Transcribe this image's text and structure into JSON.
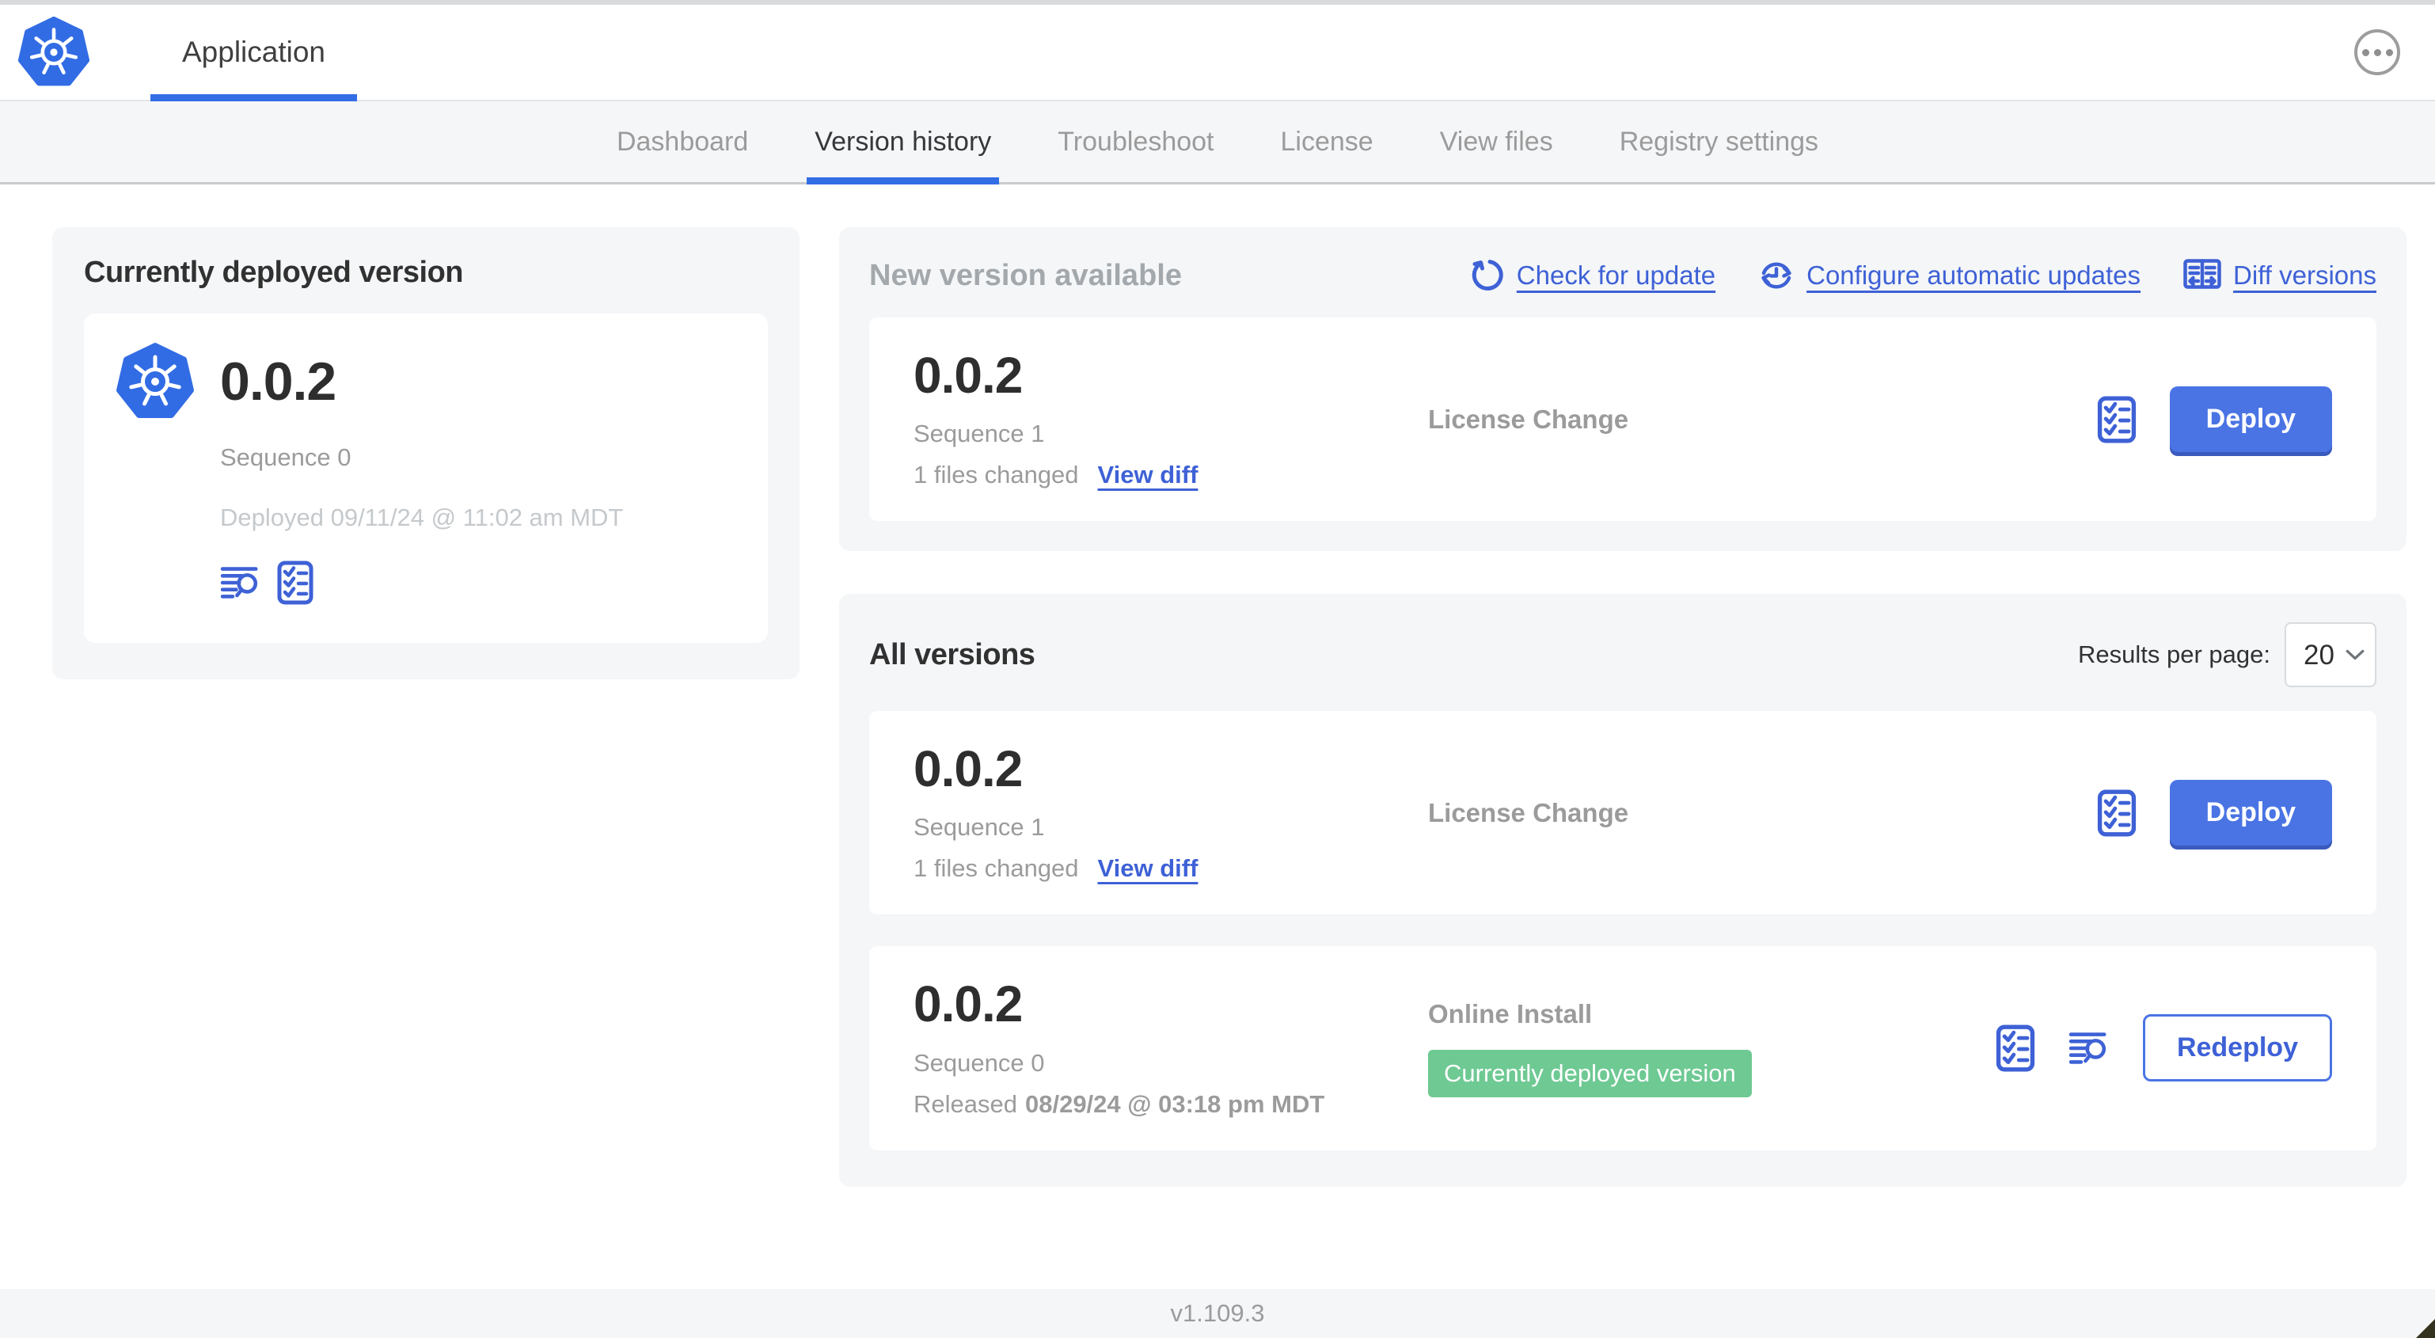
{
  "colors": {
    "accent_blue": "#326de6",
    "link_blue": "#3e61d6",
    "button_blue": "#4a74e4",
    "badge_green": "#6ec993",
    "panel_gray": "#f4f6f8"
  },
  "header": {
    "app_tab_label": "Application",
    "logo_icon": "kubernetes-wheel",
    "menu_icon": "ellipsis-circle"
  },
  "nav": {
    "active_tab": "Version history",
    "tabs": [
      {
        "label": "Dashboard"
      },
      {
        "label": "Version history"
      },
      {
        "label": "Troubleshoot"
      },
      {
        "label": "License"
      },
      {
        "label": "View files"
      },
      {
        "label": "Registry settings"
      }
    ]
  },
  "deployed_panel": {
    "title": "Currently deployed version",
    "version": "0.0.2",
    "sequence": "Sequence 0",
    "deployed_at": "Deployed 09/11/24 @ 11:02 am MDT",
    "icons": [
      "logs-magnifier",
      "preflight-checklist"
    ]
  },
  "new_version_panel": {
    "title": "New version available",
    "links": [
      {
        "label": "Check for update",
        "icon": "refresh-arrow"
      },
      {
        "label": "Configure automatic updates",
        "icon": "clock-sync"
      },
      {
        "label": "Diff versions",
        "icon": "split-diff"
      }
    ],
    "card": {
      "version": "0.0.2",
      "sequence": "Sequence 1",
      "files_changed": "1 files changed",
      "view_diff_label": "View diff",
      "source": "License Change",
      "preflight_icon": "preflight-checklist",
      "deploy_label": "Deploy"
    }
  },
  "all_versions_panel": {
    "title": "All versions",
    "results_per_page_label": "Results per page:",
    "results_per_page_value": "20",
    "cards": [
      {
        "version": "0.0.2",
        "sequence": "Sequence 1",
        "files_changed": "1 files changed",
        "view_diff_label": "View diff",
        "source": "License Change",
        "preflight_icon": "preflight-checklist",
        "deploy_label": "Deploy"
      },
      {
        "version": "0.0.2",
        "sequence": "Sequence 0",
        "released_label": "Released",
        "released_date": "08/29/24 @ 03:18 pm MDT",
        "source": "Online Install",
        "badge": "Currently deployed version",
        "preflight_icon": "preflight-checklist",
        "logs_icon": "logs-magnifier",
        "redeploy_label": "Redeploy"
      }
    ]
  },
  "footer": {
    "version": "v1.109.3"
  }
}
